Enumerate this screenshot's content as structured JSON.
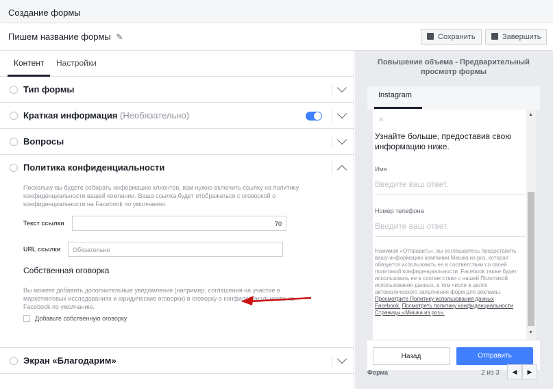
{
  "window": {
    "title": "Создание формы"
  },
  "topbar": {
    "form_name": "Пишем название формы",
    "pencil_icon": "✎",
    "save_label": "Сохранить",
    "finish_label": "Завершить"
  },
  "tabs": [
    {
      "label": "Контент",
      "active": true
    },
    {
      "label": "Настройки",
      "active": false
    }
  ],
  "sections": {
    "form_type": {
      "title": "Тип формы"
    },
    "intro": {
      "title": "Краткая информация",
      "optional": "(Необязательно)",
      "toggle_on": true
    },
    "questions": {
      "title": "Вопросы"
    },
    "privacy": {
      "title": "Политика конфиденциальности",
      "description": "Поскольку вы будете собирать информацию клиентов, вам нужно включить ссылку на политику конфиденциальности вашей компании. Ваша ссылка будет отображаться с оговоркой о конфиденциальности на Facebook по умолчанию.",
      "link_text_label": "Текст ссылки",
      "link_text_value": "70",
      "url_label": "URL ссылки",
      "url_placeholder": "Обязательно",
      "custom_title": "Собственная оговорка",
      "custom_description": "Вы можете добавить дополнительные уведомления (например, соглашения на участие в маркетинговых исследованиях и юридические оговорки) в оговорку о конфиденциальности на Facebook по умолчанию.",
      "custom_checkbox_label": "Добавьте собственную оговорку",
      "custom_checked": false
    },
    "thanks": {
      "title": "Экран «Благодарим»"
    }
  },
  "preview": {
    "title": "Повышение объема - Предварительный просмотр формы",
    "tab": "Instagram",
    "close_icon": "✕",
    "lead": "Узнайте больше, предоставив свою информацию ниже.",
    "fields": [
      {
        "label": "Имя",
        "placeholder": "Введите ваш ответ."
      },
      {
        "label": "Номер телефона",
        "placeholder": "Введите ваш ответ."
      }
    ],
    "legal_text": "Нажимая «Отправить», вы соглашаетесь предоставить вашу информацию компании Мишка из роз, которая обязуется использовать ее в соответствии со своей политикой конфиденциальности. Facebook также будет использовать ее в соответствии с нашей Политикой использования данных, в том числе в целях автоматического заполнения форм для рекламы.",
    "legal_link1": "Просмотрите Политику использования данных Facebook.",
    "legal_link2": "Посмотреть политику конфиденциальности Страницы «Мишка из роз».",
    "back_label": "Назад",
    "send_label": "Отправить",
    "pager_label": "Форма",
    "pager_count": "2 из 3",
    "prev_icon": "◀",
    "next_icon": "▶",
    "scroll_up_icon": "▲",
    "scroll_down_icon": "▼"
  },
  "colors": {
    "accent": "#4080ff",
    "annotation_arrow": "#cc1111"
  }
}
